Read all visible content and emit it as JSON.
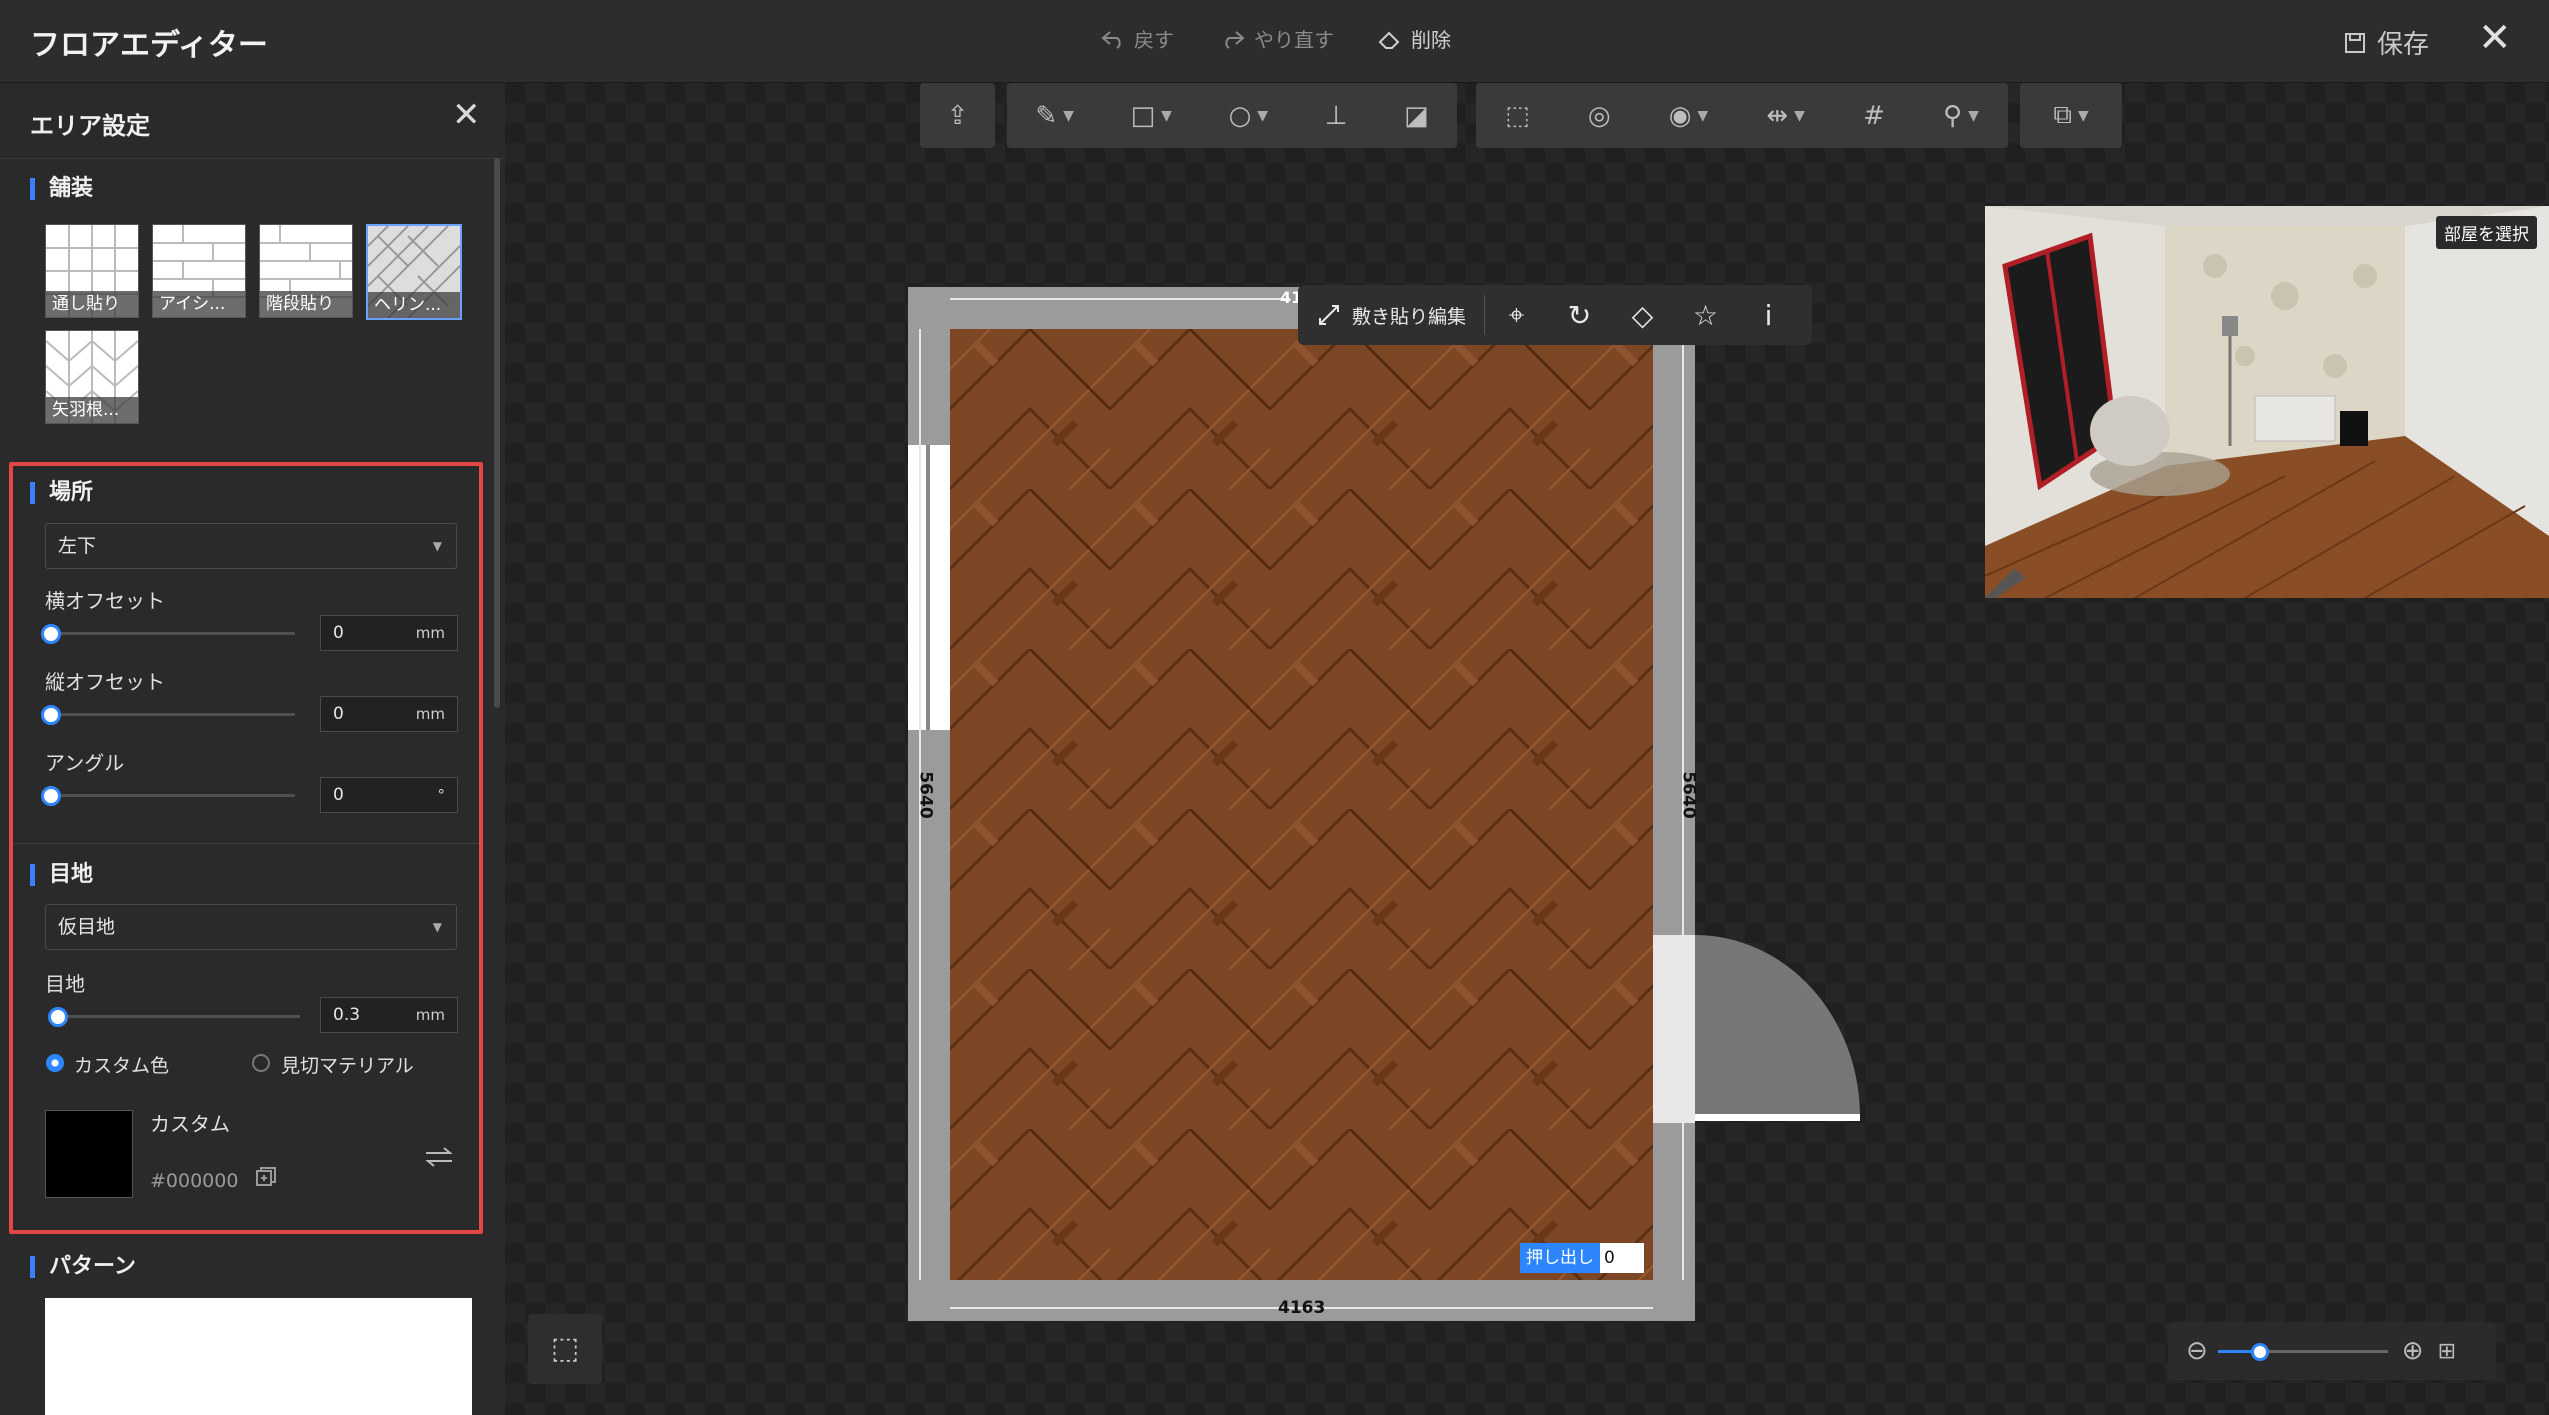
{
  "app": {
    "title": "フロアエディター",
    "undo_label": "戻す",
    "redo_label": "やり直す",
    "delete_label": "削除",
    "save_label": "保存"
  },
  "panel": {
    "title": "エリア設定",
    "paving": {
      "title": "舗装",
      "swatches": [
        {
          "label": "通し貼り",
          "selected": false
        },
        {
          "label": "アイシ...",
          "selected": false
        },
        {
          "label": "階段貼り",
          "selected": false
        },
        {
          "label": "ヘリン...",
          "selected": true
        },
        {
          "label": "矢羽根...",
          "selected": false
        }
      ]
    },
    "location": {
      "title": "場所",
      "anchor_value": "左下",
      "h_offset_label": "横オフセット",
      "h_offset_value": "0",
      "v_offset_label": "縦オフセット",
      "v_offset_value": "0",
      "angle_label": "アングル",
      "angle_value": "0",
      "unit_mm": "mm",
      "unit_deg": "°"
    },
    "joint": {
      "title": "目地",
      "type_value": "仮目地",
      "width_label": "目地",
      "width_value": "0.3",
      "unit_mm": "mm",
      "radio_custom": "カスタム色",
      "radio_material": "見切マテリアル",
      "custom_selected": true,
      "color_name": "カスタム",
      "color_hex": "#000000"
    },
    "pattern": {
      "title": "パターン"
    }
  },
  "canvas": {
    "dim_top": "41",
    "dim_bottom": "4163",
    "dim_left": "5640",
    "dim_right": "5640",
    "floor_edit_label": "敷き貼り編集",
    "extrude_label": "押し出し",
    "extrude_value": "0",
    "preview_select_label": "部屋を選択",
    "zoom_level": 0.25
  },
  "colors": {
    "accent": "#2e86ff",
    "highlight": "#e54646",
    "joint_color": "#000000"
  }
}
